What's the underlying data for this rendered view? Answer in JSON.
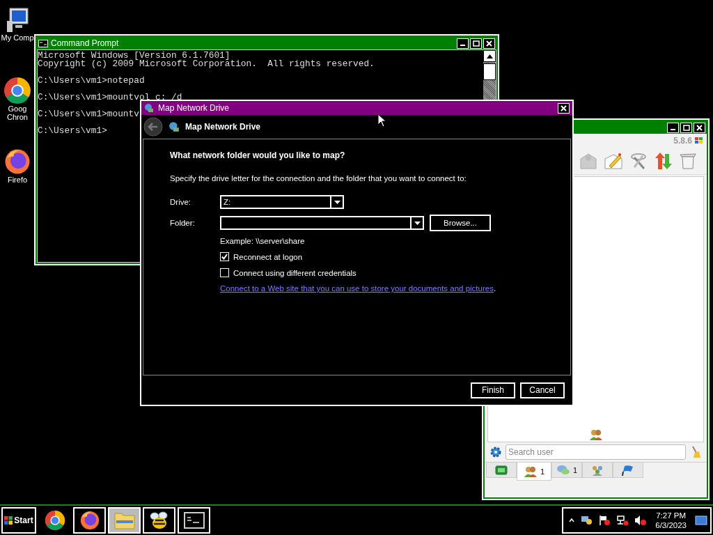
{
  "desktop_icons": [
    {
      "kind": "computer",
      "lines": [
        "My Comp"
      ]
    },
    {
      "kind": "chrome",
      "lines": [
        "Goog",
        "Chron"
      ]
    },
    {
      "kind": "firefox",
      "lines": [
        "Firefo"
      ]
    }
  ],
  "cmd_window": {
    "title": "Command Prompt",
    "blocks": [
      [
        "Microsoft Windows [Version 6.1.7601]",
        "Copyright (c) 2009 Microsoft Corporation.  All rights reserved."
      ],
      [
        "C:\\Users\\vm1>notepad"
      ],
      [
        "C:\\Users\\vm1>mountvol c: /d"
      ],
      [
        "C:\\Users\\vm1>mountv"
      ],
      [
        "C:\\Users\\vm1>"
      ]
    ]
  },
  "app_window": {
    "version": "5.8.6",
    "toolbar": [
      {
        "kind": "mail"
      },
      {
        "kind": "compose"
      },
      {
        "kind": "tools"
      },
      {
        "kind": "transfer"
      },
      {
        "kind": "trash"
      }
    ],
    "search": {
      "placeholder": "Search user"
    },
    "tabs": [
      {
        "kind": "status",
        "selected": false
      },
      {
        "kind": "contacts",
        "count": "1",
        "selected": true
      },
      {
        "kind": "chats",
        "count": "1",
        "selected": false
      },
      {
        "kind": "groups",
        "selected": false
      },
      {
        "kind": "flag",
        "selected": false
      }
    ]
  },
  "dialog": {
    "title": "Map Network Drive",
    "header": "Map Network Drive",
    "heading": "What network folder would you like to map?",
    "instruction": "Specify the drive letter for the connection and the folder that you want to connect to:",
    "drive": {
      "label": "Drive:",
      "value": "Z:"
    },
    "folder": {
      "label": "Folder:"
    },
    "browse": "Browse...",
    "example": "Example: \\\\server\\share",
    "options": [
      {
        "label": "Reconnect at logon",
        "checked": true
      },
      {
        "label": "Connect using different credentials",
        "checked": false
      }
    ],
    "link": "Connect to a Web site that you can use to store your documents and pictures",
    "link_suffix": ".",
    "buttons": [
      "Finish",
      "Cancel"
    ]
  },
  "taskbar": {
    "start": "Start",
    "apps": [
      {
        "kind": "chrome",
        "selected": false
      },
      {
        "kind": "firefox",
        "selected": false
      },
      {
        "kind": "explorer",
        "selected": true
      },
      {
        "kind": "bee",
        "selected": false
      },
      {
        "kind": "cmd",
        "selected": false
      }
    ],
    "tray": {
      "time": "7:27 PM",
      "date": "6/3/2023"
    }
  }
}
